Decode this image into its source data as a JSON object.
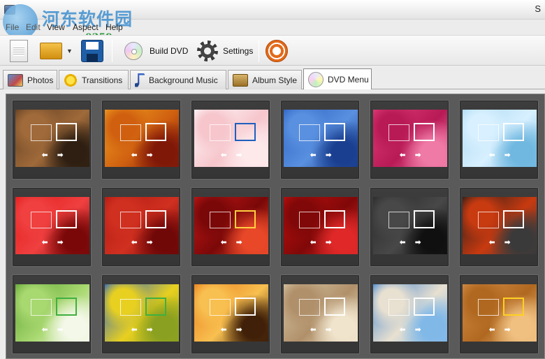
{
  "window": {
    "title": "S"
  },
  "watermark": {
    "site_name": "河东软件园",
    "url": "www.pc0359.cn"
  },
  "menu": [
    {
      "label": "File"
    },
    {
      "label": "Edit"
    },
    {
      "label": "View"
    },
    {
      "label": "Aspect"
    },
    {
      "label": "Help"
    }
  ],
  "toolbar": {
    "build_dvd_label": "Build DVD",
    "settings_label": "Settings"
  },
  "tabs": [
    {
      "label": "Photos",
      "icon": "photos-icon"
    },
    {
      "label": "Transitions",
      "icon": "star-icon"
    },
    {
      "label": "Background Music",
      "icon": "music-note-icon"
    },
    {
      "label": "Album Style",
      "icon": "album-icon"
    },
    {
      "label": "DVD Menu",
      "icon": "dvd-icon",
      "active": true
    }
  ],
  "menu_templates": [
    {
      "theme": "autumn-leaves-dark",
      "colors": [
        "#5a3a20",
        "#a06a3a",
        "#2e1f12"
      ],
      "box_color": "#ffffff"
    },
    {
      "theme": "autumn-leaves-orange",
      "colors": [
        "#f0a020",
        "#d06010",
        "#801808"
      ],
      "box_color": "#ffffff"
    },
    {
      "theme": "pink-shoes",
      "colors": [
        "#ffffff",
        "#f6c6cc",
        "#fde8ea"
      ],
      "box_color": "#1e5fc0"
    },
    {
      "theme": "blue-teddy-gift",
      "colors": [
        "#2a60c0",
        "#5a90e0",
        "#1a3f90"
      ],
      "box_color": "#ffffff"
    },
    {
      "theme": "pink-teddy",
      "colors": [
        "#e0407a",
        "#b81a56",
        "#f07aa6"
      ],
      "box_color": "#ffffff"
    },
    {
      "theme": "blue-balloon-cake",
      "colors": [
        "#a8d8f0",
        "#d8f0ff",
        "#70b8e0"
      ],
      "box_color": "#ffffff"
    },
    {
      "theme": "red-swirl",
      "colors": [
        "#e01818",
        "#f04040",
        "#7a0808"
      ],
      "box_color": "#ffffff"
    },
    {
      "theme": "red-ribbon",
      "colors": [
        "#b01810",
        "#d03020",
        "#700808"
      ],
      "box_color": "#ffffff"
    },
    {
      "theme": "christmas-ornaments",
      "colors": [
        "#c81818",
        "#7a0808",
        "#e84828"
      ],
      "box_color": "#ffd040"
    },
    {
      "theme": "snowman-red",
      "colors": [
        "#c01010",
        "#800808",
        "#e02828"
      ],
      "box_color": "#ffffff"
    },
    {
      "theme": "dark-chapter",
      "colors": [
        "#282828",
        "#484848",
        "#101010"
      ],
      "box_color": "#ffffff"
    },
    {
      "theme": "dark-fire",
      "colors": [
        "#1a1a1a",
        "#c83a10",
        "#3a3a3a"
      ],
      "box_color": "#ffffff"
    },
    {
      "theme": "white-flower",
      "colors": [
        "#5aa030",
        "#a8d870",
        "#f4f8e8"
      ],
      "box_color": "#40b040"
    },
    {
      "theme": "blue-sky-meadow",
      "colors": [
        "#1a5ad0",
        "#e8d020",
        "#8aa020"
      ],
      "box_color": "#40b040"
    },
    {
      "theme": "palm-sunset",
      "colors": [
        "#e87818",
        "#f8c050",
        "#402008"
      ],
      "box_color": "#ffffff"
    },
    {
      "theme": "vintage-map",
      "colors": [
        "#d8c8a8",
        "#b0906a",
        "#f0e4cc"
      ],
      "box_color": "#ffffff"
    },
    {
      "theme": "seashell-beach",
      "colors": [
        "#3a80d0",
        "#e8e0d0",
        "#80b8e8"
      ],
      "box_color": "#ffffff"
    },
    {
      "theme": "sepia-clock",
      "colors": [
        "#d89048",
        "#b06820",
        "#f0c080"
      ],
      "box_color": "#ffd020"
    }
  ]
}
